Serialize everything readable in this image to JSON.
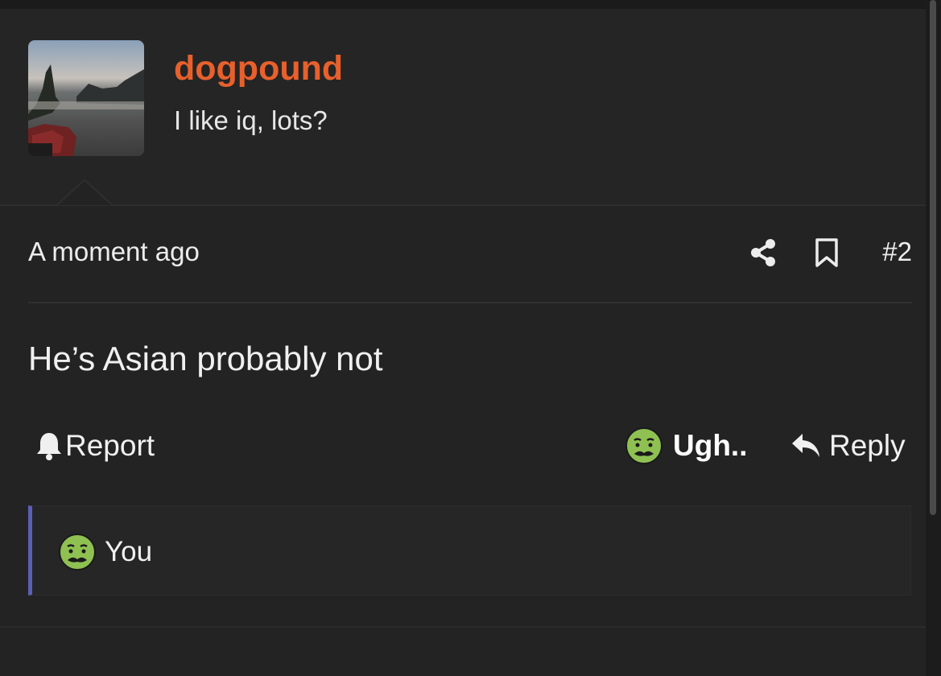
{
  "profile": {
    "username": "dogpound",
    "bio": "I like iq, lots?"
  },
  "post": {
    "timestamp": "A moment ago",
    "number": "#2",
    "content": "He’s Asian probably not"
  },
  "actions": {
    "report_label": "Report",
    "reaction_label": "Ugh..",
    "reply_label": "Reply"
  },
  "reactions": [
    {
      "icon": "nauseated-face-icon",
      "user": "You"
    }
  ],
  "colors": {
    "background": "#232323",
    "username": "#e8602c",
    "reaction_accent": "#5a5fb8",
    "emoji_green": "#8fc152"
  },
  "icons": {
    "share": "share-icon",
    "bookmark": "bookmark-icon",
    "report": "bell-icon",
    "reply": "reply-arrow-icon"
  }
}
